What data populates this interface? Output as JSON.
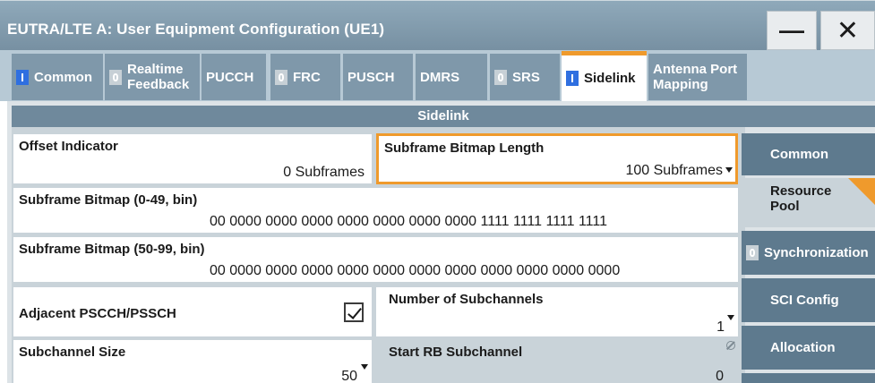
{
  "window": {
    "title": "EUTRA/LTE A: User Equipment Configuration (UE1)",
    "minimize_symbol": "—",
    "close_symbol": "✕"
  },
  "tabs": [
    {
      "label": "Common",
      "indicator": "on"
    },
    {
      "label": "Realtime Feedback",
      "line1": "Realtime",
      "line2": "Feedback",
      "indicator": "off"
    },
    {
      "label": "PUCCH"
    },
    {
      "label": "FRC",
      "indicator": "off"
    },
    {
      "label": "PUSCH"
    },
    {
      "label": "DMRS"
    },
    {
      "label": "SRS",
      "indicator": "off"
    },
    {
      "label": "Sidelink",
      "indicator": "on",
      "active": true
    },
    {
      "label": "Antenna Port Mapping",
      "line1": "Antenna Port",
      "line2": "Mapping"
    }
  ],
  "section_title": "Sidelink",
  "fields": {
    "offset_indicator": {
      "label": "Offset Indicator",
      "value": "0 Subframes"
    },
    "subframe_bitmap_length": {
      "label": "Subframe Bitmap Length",
      "value": "100 Subframes"
    },
    "subframe_bitmap_0_49": {
      "label": "Subframe Bitmap (0-49, bin)",
      "value": "00 0000 0000 0000 0000 0000 0000 0000 1111 1111 1111 1111"
    },
    "subframe_bitmap_50_99": {
      "label": "Subframe Bitmap (50-99, bin)",
      "value": "00 0000 0000 0000 0000 0000 0000 0000 0000 0000 0000 0000"
    },
    "adjacent_pscch_pssch": {
      "label": "Adjacent PSCCH/PSSCH",
      "checked": true
    },
    "number_of_subchannels": {
      "label": "Number of Subchannels",
      "value": "1"
    },
    "subchannel_size": {
      "label": "Subchannel Size",
      "value": "50"
    },
    "start_rb_subchannel": {
      "label": "Start RB Subchannel",
      "value": "0"
    }
  },
  "side_menu": [
    {
      "label": "Common"
    },
    {
      "label": "Resource Pool",
      "line1": "Resource",
      "line2": "Pool",
      "active": true
    },
    {
      "label": "Synchronization",
      "indicator": "off"
    },
    {
      "label": "SCI Config"
    },
    {
      "label": "Allocation"
    }
  ],
  "colors": {
    "accent": "#ef9a2c",
    "tab_bg": "#7f98aa",
    "section_bar": "#6f899c",
    "side_button": "#5e7a8e",
    "indicator_on": "#2f6fe0"
  }
}
